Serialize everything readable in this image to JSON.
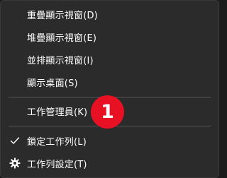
{
  "menu": {
    "items": [
      {
        "label": "重疊顯示視窗(D)"
      },
      {
        "label": "堆疊顯示視窗(E)"
      },
      {
        "label": "並排顯示視窗(I)"
      },
      {
        "label": "顯示桌面(S)"
      },
      {
        "label": "工作管理員(K)"
      },
      {
        "label": "鎖定工作列(L)",
        "checked": true,
        "icon": "checkmark-icon"
      },
      {
        "label": "工作列設定(T)",
        "icon": "gear-icon"
      }
    ]
  },
  "annotation": {
    "step_number": "1",
    "color": "#e81123"
  }
}
